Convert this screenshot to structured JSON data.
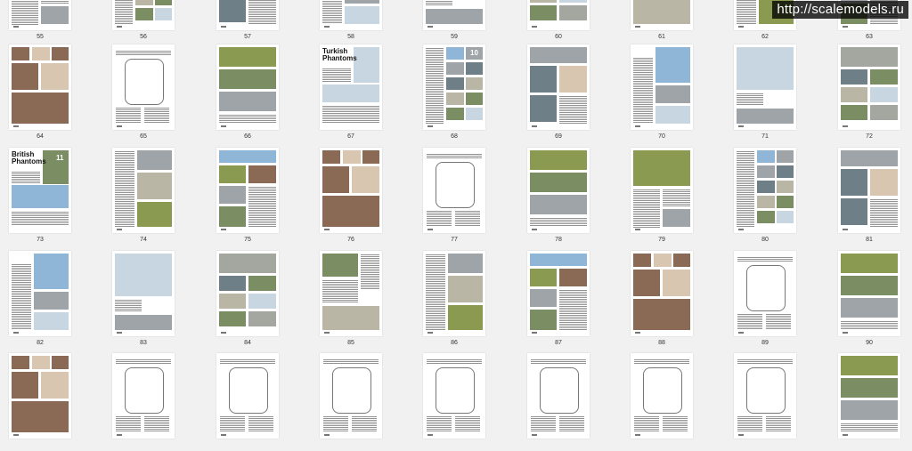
{
  "watermark": "http://scalemodels.ru",
  "section_headings": {
    "turkish": "Turkish Phantoms",
    "british": "British Phantoms"
  },
  "chapter_markers": {
    "p68": "10",
    "p73": "11"
  },
  "page_numbers": [
    "55",
    "56",
    "57",
    "58",
    "59",
    "60",
    "61",
    "62",
    "63",
    "64",
    "65",
    "66",
    "67",
    "68",
    "69",
    "70",
    "71",
    "72",
    "73",
    "74",
    "75",
    "76",
    "77",
    "78",
    "79",
    "80",
    "81",
    "82",
    "83",
    "84",
    "85",
    "86",
    "87",
    "88",
    "89",
    "90"
  ],
  "colors": {
    "jet_green": "#8a9a50",
    "sky_blue": "#8fb6d6",
    "grey_jet": "#9ea4a8",
    "interior_brown": "#8a6a55",
    "watermark_bg": "#000000"
  }
}
